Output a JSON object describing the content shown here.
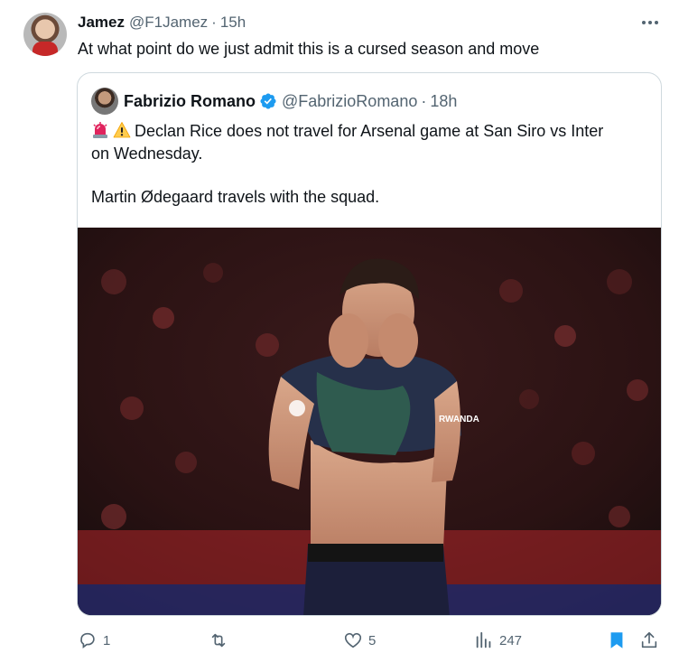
{
  "tweet": {
    "author_name": "Jamez",
    "author_handle": "@F1Jamez",
    "separator": "·",
    "time": "15h",
    "text": "At what point do we just admit this is a cursed season and move"
  },
  "quote": {
    "author_name": "Fabrizio Romano",
    "author_handle": "@FabrizioRomano",
    "separator": "·",
    "time": "18h",
    "line1": "Declan Rice does not travel for Arsenal game at San Siro vs Inter",
    "line2": "on Wednesday.",
    "line3": "Martin Ødegaard travels with the squad.",
    "emojis": [
      "siren-emoji",
      "warning-emoji"
    ],
    "shirt_text": "RWANDA"
  },
  "actions": {
    "replies": "1",
    "retweets": "",
    "likes": "5",
    "views": "247"
  },
  "colors": {
    "text": "#0f1419",
    "secondary": "#536471",
    "border": "#cfd9de",
    "verified": "#1d9bf0",
    "bookmark": "#1d9bf0"
  }
}
